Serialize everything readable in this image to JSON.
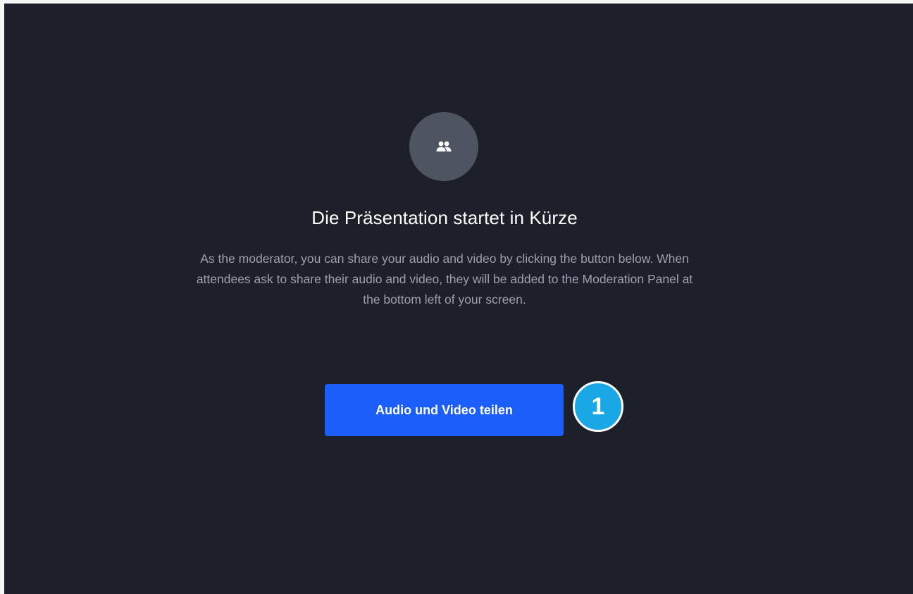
{
  "placeholder": {
    "icon": "people-icon",
    "title": "Die Präsentation startet in Kürze",
    "description": "As the moderator, you can share your audio and video by clicking the button below. When attendees ask to share their audio and video, they will be added to the Moderation Panel at the bottom left of your screen.",
    "share_button_label": "Audio und Video teilen"
  },
  "annotation": {
    "step_number": "1"
  },
  "colors": {
    "background": "#1d202a",
    "icon_circle": "#4f5461",
    "button": "#1c5efa",
    "badge": "#1aa7e6"
  }
}
